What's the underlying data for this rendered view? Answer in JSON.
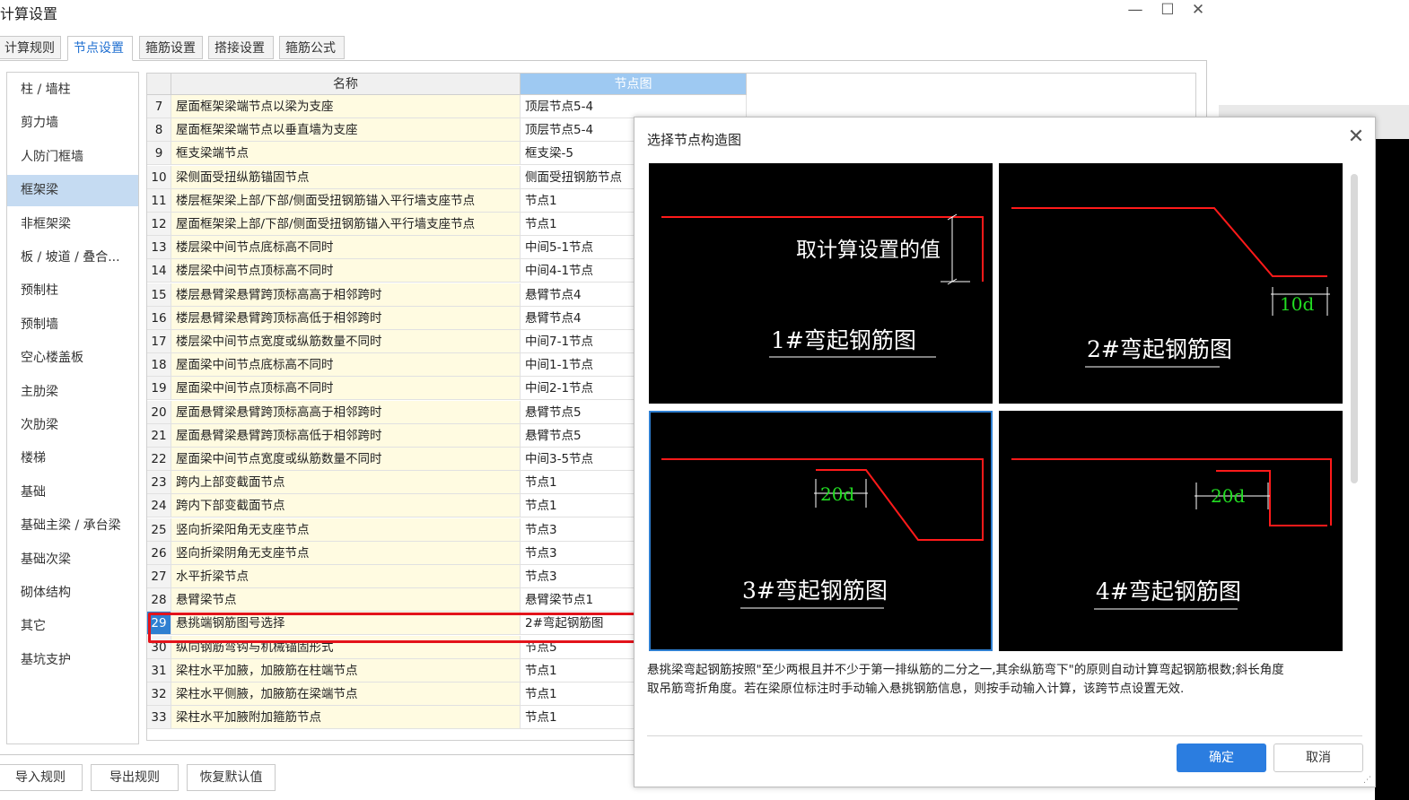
{
  "window": {
    "title": "计算设置",
    "minimize": "—",
    "maximize": "☐",
    "close": "✕"
  },
  "tabs": [
    {
      "label": "计算规则",
      "active": false
    },
    {
      "label": "节点设置",
      "active": true
    },
    {
      "label": "箍筋设置",
      "active": false
    },
    {
      "label": "搭接设置",
      "active": false
    },
    {
      "label": "箍筋公式",
      "active": false
    }
  ],
  "sidebar": {
    "items": [
      "柱 / 墙柱",
      "剪力墙",
      "人防门框墙",
      "框架梁",
      "非框架梁",
      "板 / 坡道 / 叠合...",
      "预制柱",
      "预制墙",
      "空心楼盖板",
      "主肋梁",
      "次肋梁",
      "楼梯",
      "基础",
      "基础主梁 / 承台梁",
      "基础次梁",
      "砌体结构",
      "其它",
      "基坑支护"
    ],
    "active_index": 3
  },
  "table": {
    "headers": {
      "name": "名称",
      "node": "节点图"
    },
    "rows": [
      {
        "num": "7",
        "name": "屋面框架梁端节点以梁为支座",
        "node": "顶层节点5-4"
      },
      {
        "num": "8",
        "name": "屋面框架梁端节点以垂直墙为支座",
        "node": "顶层节点5-4"
      },
      {
        "num": "9",
        "name": "框支梁端节点",
        "node": "框支梁-5"
      },
      {
        "num": "10",
        "name": "梁侧面受扭纵筋锚固节点",
        "node": "侧面受扭钢筋节点"
      },
      {
        "num": "11",
        "name": "楼层框架梁上部/下部/侧面受扭钢筋锚入平行墙支座节点",
        "node": "节点1"
      },
      {
        "num": "12",
        "name": "屋面框架梁上部/下部/侧面受扭钢筋锚入平行墙支座节点",
        "node": "节点1"
      },
      {
        "num": "13",
        "name": "楼层梁中间节点底标高不同时",
        "node": "中间5-1节点"
      },
      {
        "num": "14",
        "name": "楼层梁中间节点顶标高不同时",
        "node": "中间4-1节点"
      },
      {
        "num": "15",
        "name": "楼层悬臂梁悬臂跨顶标高高于相邻跨时",
        "node": "悬臂节点4"
      },
      {
        "num": "16",
        "name": "楼层悬臂梁悬臂跨顶标高低于相邻跨时",
        "node": "悬臂节点4"
      },
      {
        "num": "17",
        "name": "楼层梁中间节点宽度或纵筋数量不同时",
        "node": "中间7-1节点"
      },
      {
        "num": "18",
        "name": "屋面梁中间节点底标高不同时",
        "node": "中间1-1节点"
      },
      {
        "num": "19",
        "name": "屋面梁中间节点顶标高不同时",
        "node": "中间2-1节点"
      },
      {
        "num": "20",
        "name": "屋面悬臂梁悬臂跨顶标高高于相邻跨时",
        "node": "悬臂节点5"
      },
      {
        "num": "21",
        "name": "屋面悬臂梁悬臂跨顶标高低于相邻跨时",
        "node": "悬臂节点5"
      },
      {
        "num": "22",
        "name": "屋面梁中间节点宽度或纵筋数量不同时",
        "node": "中间3-5节点"
      },
      {
        "num": "23",
        "name": "跨内上部变截面节点",
        "node": "节点1"
      },
      {
        "num": "24",
        "name": "跨内下部变截面节点",
        "node": "节点1"
      },
      {
        "num": "25",
        "name": "竖向折梁阳角无支座节点",
        "node": "节点3"
      },
      {
        "num": "26",
        "name": "竖向折梁阴角无支座节点",
        "node": "节点3"
      },
      {
        "num": "27",
        "name": "水平折梁节点",
        "node": "节点3"
      },
      {
        "num": "28",
        "name": "悬臂梁节点",
        "node": "悬臂梁节点1"
      },
      {
        "num": "29",
        "name": "悬挑端钢筋图号选择",
        "node": "2#弯起钢筋图"
      },
      {
        "num": "30",
        "name": "纵向钢筋弯钩与机械锚固形式",
        "node": "节点5"
      },
      {
        "num": "31",
        "name": "梁柱水平加腋，加腋筋在柱端节点",
        "node": "节点1"
      },
      {
        "num": "32",
        "name": "梁柱水平侧腋，加腋筋在梁端节点",
        "node": "节点1"
      },
      {
        "num": "33",
        "name": "梁柱水平加腋附加箍筋节点",
        "node": "节点1"
      }
    ],
    "selected_index": 22
  },
  "bottom_buttons": {
    "import": "导入规则",
    "export": "导出规则",
    "restore": "恢复默认值"
  },
  "dialog": {
    "title": "选择节点构造图",
    "close": "✕",
    "panels": [
      {
        "caption": "1#弯起钢筋图",
        "annotation": "取计算设置的值"
      },
      {
        "caption": "2#弯起钢筋图",
        "annotation": "10d"
      },
      {
        "caption": "3#弯起钢筋图",
        "annotation": "20d"
      },
      {
        "caption": "4#弯起钢筋图",
        "annotation": "20d"
      }
    ],
    "selected_panel": 2,
    "description_line1": "悬挑梁弯起钢筋按照\"至少两根且并不少于第一排纵筋的二分之一,其余纵筋弯下\"的原则自动计算弯起钢筋根数;斜长角度",
    "description_line2": "取吊筋弯折角度。若在梁原位标注时手动输入悬挑钢筋信息，则按手动输入计算，该跨节点设置无效.",
    "ok": "确定",
    "cancel": "取消"
  },
  "colors": {
    "accent": "#2b7de0",
    "highlight": "#e3131b",
    "rebar": "#ff1a1a",
    "dimension_text": "#22dd22"
  }
}
